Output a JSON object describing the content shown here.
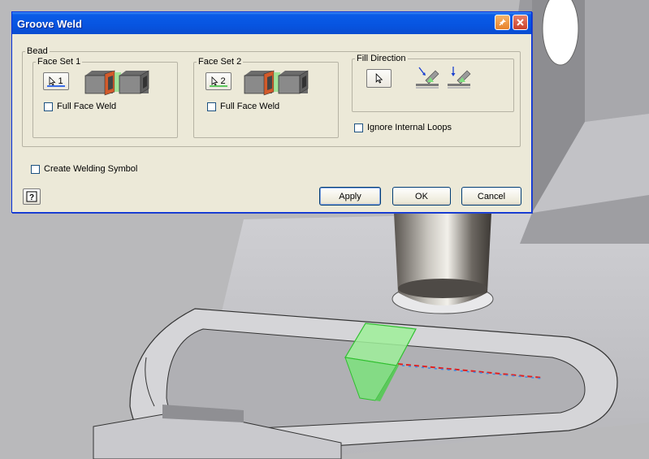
{
  "dialog": {
    "title": "Groove Weld",
    "bead_label": "Bead",
    "face_set_1": {
      "label": "Face Set 1",
      "pick_number": "1",
      "full_face_weld_label": "Full Face Weld",
      "full_face_weld_checked": false
    },
    "face_set_2": {
      "label": "Face Set 2",
      "pick_number": "2",
      "full_face_weld_label": "Full Face Weld",
      "full_face_weld_checked": false
    },
    "fill_direction": {
      "label": "Fill Direction"
    },
    "ignore_internal_loops_label": "Ignore Internal Loops",
    "ignore_internal_loops_checked": false,
    "create_welding_symbol_label": "Create Welding Symbol",
    "create_welding_symbol_checked": false,
    "buttons": {
      "apply": "Apply",
      "ok": "OK",
      "cancel": "Cancel",
      "help": "?"
    }
  },
  "icons": [
    "pin-icon",
    "close-icon",
    "cursor-icon",
    "face-set-1-preview-icon",
    "face-set-2-preview-icon",
    "fill-direction-1-icon",
    "fill-direction-2-icon",
    "help-icon"
  ],
  "colors": {
    "titlebar": "#0a5ce8",
    "dialog_bg": "#ece9d8",
    "weld_preview": "#7fe07f",
    "face_set_1_underline": "#3a6ce8",
    "face_set_2_underline": "#5fc95f",
    "edge_red": "#e02020",
    "edge_blue": "#3a8ae8"
  }
}
